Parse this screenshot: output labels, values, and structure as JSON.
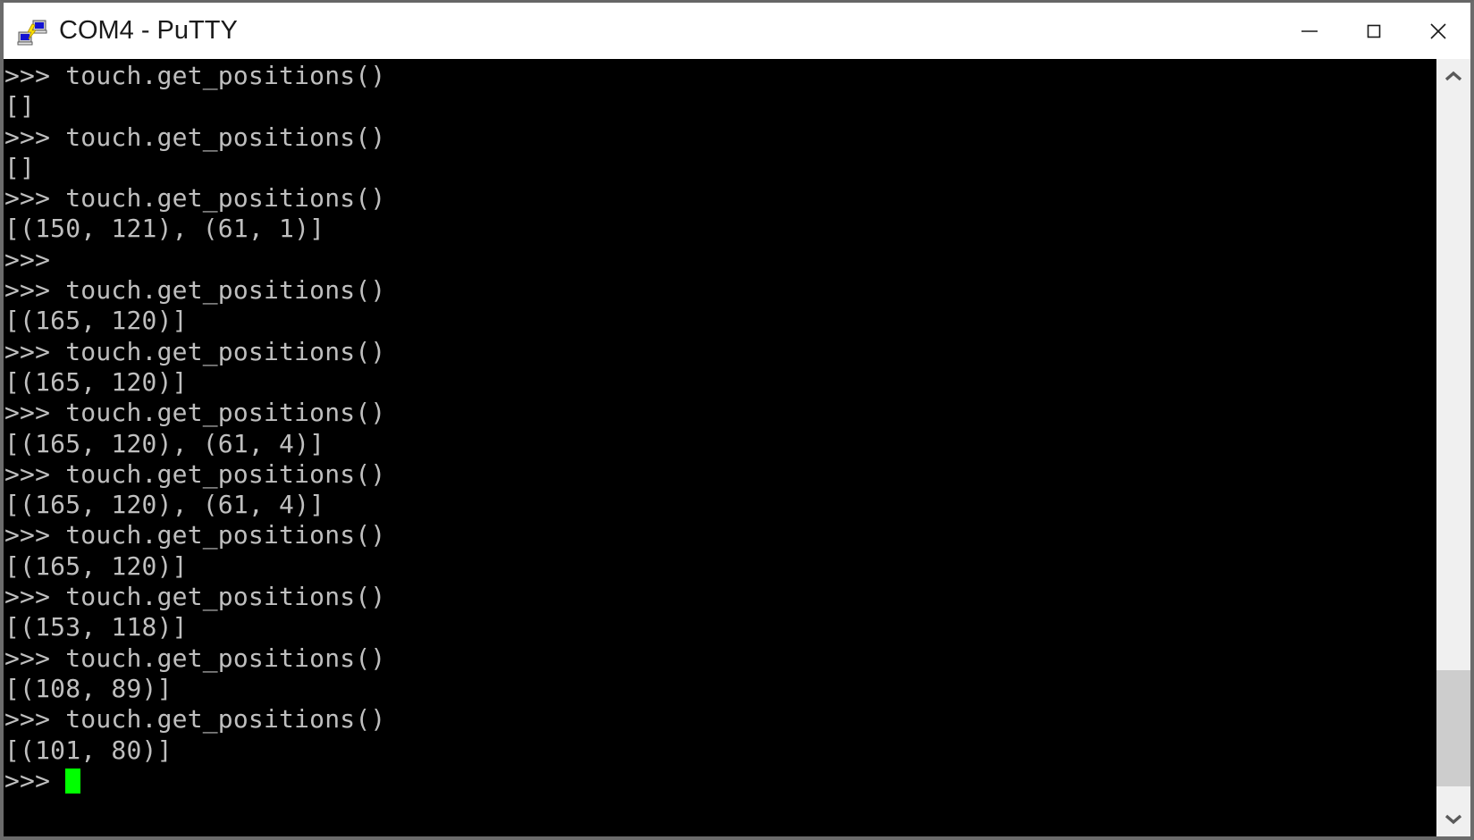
{
  "window": {
    "title": "COM4 - PuTTY",
    "app_icon": "putty-network-icon",
    "border_color": "#6b6b6b",
    "titlebar_background": "#ffffff",
    "title_color": "#1a1a1a"
  },
  "controls": {
    "minimize": {
      "name": "minimize",
      "glyph": "—"
    },
    "maximize": {
      "name": "maximize",
      "glyph": "□"
    },
    "close": {
      "name": "close",
      "glyph": "✕"
    }
  },
  "terminal": {
    "background": "#000000",
    "foreground": "#bfbfbf",
    "cursor_color": "#00ff00",
    "prompt": ">>>",
    "command": "touch.get_positions()",
    "lines": [
      ">>> touch.get_positions()",
      "[]",
      ">>> touch.get_positions()",
      "[]",
      ">>> touch.get_positions()",
      "[(150, 121), (61, 1)]",
      ">>>",
      ">>> touch.get_positions()",
      "[(165, 120)]",
      ">>> touch.get_positions()",
      "[(165, 120)]",
      ">>> touch.get_positions()",
      "[(165, 120), (61, 4)]",
      ">>> touch.get_positions()",
      "[(165, 120), (61, 4)]",
      ">>> touch.get_positions()",
      "[(165, 120)]",
      ">>> touch.get_positions()",
      "[(153, 118)]",
      ">>> touch.get_positions()",
      "[(108, 89)]",
      ">>> touch.get_positions()",
      "[(101, 80)]"
    ],
    "prompt_line": ">>> ",
    "outputs": [
      {
        "command": "touch.get_positions()",
        "result": "[]"
      },
      {
        "command": "touch.get_positions()",
        "result": "[]"
      },
      {
        "command": "touch.get_positions()",
        "result": "[(150, 121), (61, 1)]"
      },
      {
        "command": "touch.get_positions()",
        "result": "[(165, 120)]"
      },
      {
        "command": "touch.get_positions()",
        "result": "[(165, 120)]"
      },
      {
        "command": "touch.get_positions()",
        "result": "[(165, 120), (61, 4)]"
      },
      {
        "command": "touch.get_positions()",
        "result": "[(165, 120), (61, 4)]"
      },
      {
        "command": "touch.get_positions()",
        "result": "[(165, 120)]"
      },
      {
        "command": "touch.get_positions()",
        "result": "[(153, 118)]"
      },
      {
        "command": "touch.get_positions()",
        "result": "[(108, 89)]"
      },
      {
        "command": "touch.get_positions()",
        "result": "[(101, 80)]"
      }
    ]
  },
  "scrollbar": {
    "track_color": "#f0f0f0",
    "thumb_color": "#cdcdcd",
    "up_arrow": "chevron-up",
    "down_arrow": "chevron-down",
    "thumb_top_pct": 81.5,
    "thumb_height_pct": 16.5
  }
}
